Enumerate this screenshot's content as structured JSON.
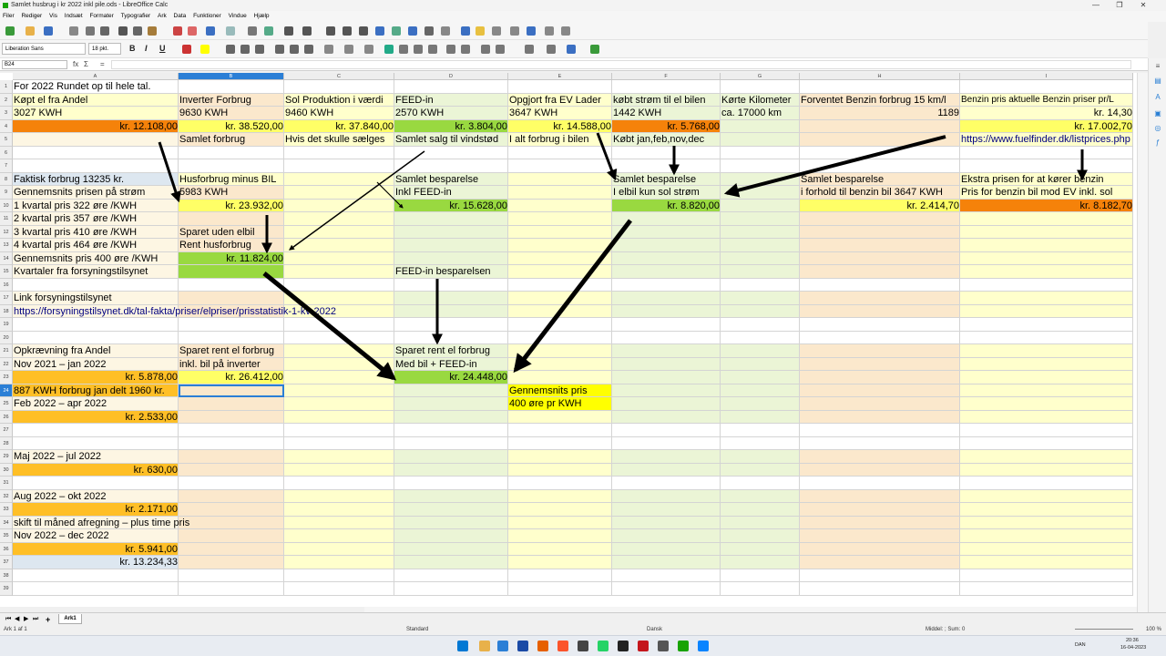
{
  "window": {
    "title": "Samlet husbrug i kr 2022 inkl pile.ods - LibreOffice Calc",
    "minimize": "—",
    "maximize": "❐",
    "close": "✕"
  },
  "menu": [
    "Filer",
    "Rediger",
    "Vis",
    "Indsæt",
    "Formater",
    "Typografier",
    "Ark",
    "Data",
    "Funktioner",
    "Vindue",
    "Hjælp"
  ],
  "toolbar": {
    "font_name": "Liberation Sans",
    "font_size": "18 pkt.",
    "bold": "B",
    "italic": "I",
    "underline": "U"
  },
  "formula_bar": {
    "cell_ref": "B24",
    "sum_symbol": "Σ",
    "fx_symbol": "fx",
    "equals_symbol": "=",
    "content": ""
  },
  "grid": {
    "columns": [
      "A",
      "B",
      "C",
      "D",
      "E",
      "F",
      "G",
      "H",
      "I"
    ],
    "selected_column": "B",
    "selected_row": "24",
    "rows": [
      "1",
      "2",
      "3",
      "4",
      "5",
      "6",
      "7",
      "8",
      "9",
      "10",
      "11",
      "12",
      "13",
      "14",
      "15",
      "16",
      "17",
      "18",
      "19",
      "20",
      "21",
      "22",
      "23",
      "24",
      "25",
      "26",
      "27",
      "28",
      "29",
      "30",
      "31",
      "32",
      "33",
      "34",
      "35",
      "36",
      "37",
      "38",
      "39"
    ],
    "cells": {
      "A1": "For 2022 Rundet op til hele tal.",
      "A2": "Køpt el fra Andel",
      "B2": "Inverter Forbrug",
      "C2": "Sol Produktion i værdi",
      "D2": "FEED-in",
      "E2": "Opgjort fra EV Lader",
      "F2": "købt strøm til el bilen",
      "G2": "Kørte Kilometer",
      "H2": "Forventet Benzin forbrug 15 km/l",
      "I2": "Benzin pris aktuelle Benzin priser pr/L",
      "A3": "3027 KWH",
      "B3": "9630 KWH",
      "C3": "9460 KWH",
      "D3": "2570 KWH",
      "E3": "3647 KWH",
      "F3": "1442 KWH",
      "G3": "ca. 17000 km",
      "H3": "1189",
      "I3": "kr. 14,30",
      "A4": "kr. 12.108,00",
      "B4": "kr. 38.520,00",
      "C4": "kr. 37.840,00",
      "D4": "kr. 3.804,00",
      "E4": "kr. 14.588,00",
      "F4": "kr. 5.768,00",
      "I4": "kr. 17.002,70",
      "B5": "Samlet forbrug",
      "C5": "Hvis det skulle sælges",
      "D5": "Samlet salg til vindstød",
      "E5": "I alt forbrug i bilen",
      "F5": "Købt jan,feb,nov,dec",
      "I5": "https://www.fuelfinder.dk/listprices.php",
      "A8": "Faktisk forbrug 13235 kr.",
      "B8": "Husforbrug minus BIL",
      "D8": "Samlet besparelse",
      "F8": "Samlet besparelse",
      "H8": "Samlet besparelse",
      "I8": "Ekstra prisen for at kører benzin",
      "A9": "Gennemsnits prisen på strøm",
      "B9": "5983 KWH",
      "D9": "Inkl FEED-in",
      "F9": "I elbil kun sol strøm",
      "H9": "i forhold til benzin bil 3647 KWH",
      "I9": "Pris for benzin bil mod EV inkl. sol",
      "A10": "1 kvartal pris 322 øre /KWH",
      "B10": "kr. 23.932,00",
      "D10": "kr. 15.628,00",
      "F10": "kr. 8.820,00",
      "H10": "kr. 2.414,70",
      "I10": "kr. 8.182,70",
      "A11": "2 kvartal pris 357 øre /KWH",
      "A12": "3 kvartal pris 410 øre /KWH",
      "B12": "Sparet uden elbil",
      "A13": "4 kvartal pris 464 øre /KWH",
      "B13": "Rent husforbrug",
      "A14": "Gennemsnits pris 400 øre /KWH",
      "B14": "kr. 11.824,00",
      "A15": "Kvartaler fra forsyningstilsynet",
      "D15": "FEED-in besparelsen",
      "A17": "Link forsyningstilsynet",
      "A18": "https://forsyningstilsynet.dk/tal-fakta/priser/elpriser/prisstatistik-1-kv-2022",
      "A21": "Opkrævning fra Andel",
      "B21": "Sparet rent el forbrug",
      "D21": "Sparet rent el forbrug",
      "A22": "Nov 2021 – jan 2022",
      "B22": "inkl. bil på inverter",
      "D22": "Med bil + FEED-in",
      "A23": "kr. 5.878,00",
      "B23": "kr. 26.412,00",
      "D23": "kr. 24.448,00",
      "A24": "887 KWH forbrug jan delt 1960 kr.",
      "E24": "Gennemsnits pris",
      "A25": "Feb 2022 – apr 2022",
      "E25": "400 øre pr KWH",
      "A26": "kr. 2.533,00",
      "A29": "Maj 2022 – jul 2022",
      "A30": "kr. 630,00",
      "A32": "Aug 2022 – okt 2022",
      "A33": "kr. 2.171,00",
      "A34": "skift til måned afregning – plus time pris",
      "A35": "Nov 2022 – dec 2022",
      "A36": "kr. 5.941,00",
      "A37": "kr. 13.234,33"
    }
  },
  "colors": {
    "orange": "#f5820a",
    "yellow": "#ffff66",
    "green": "#99d940",
    "gold": "#ffbf26",
    "light_yellow": "#ffffcc",
    "light_green": "#ebf5d6",
    "light_orange": "#fbe8cc",
    "light_blue": "#dde7f0",
    "pale": "#fdf6e3"
  },
  "sheet": {
    "tab": "Ark1",
    "status_sheet": "Ark 1 af 1",
    "page_style": "Standard",
    "language": "Dansk",
    "selection_summary": "Middel: ; Sum: 0",
    "zoom": "100 %"
  },
  "tray": {
    "lang": "DAN",
    "time": "20:36",
    "date": "16-04-2023"
  }
}
